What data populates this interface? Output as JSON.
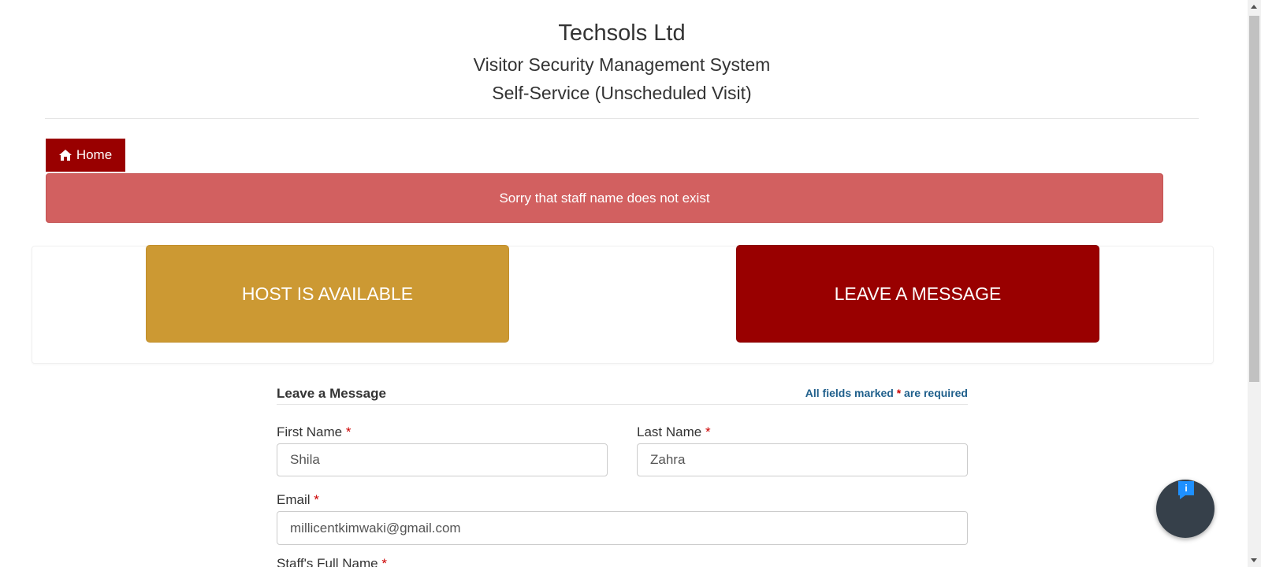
{
  "header": {
    "company": "Techsols Ltd",
    "system": "Visitor Security Management System",
    "mode": "Self-Service (Unscheduled Visit)"
  },
  "nav": {
    "home_label": "Home",
    "home_icon": "home-icon"
  },
  "alert": {
    "message": "Sorry that staff name does not exist",
    "color": "#d26060"
  },
  "actions": {
    "host_available": "HOST IS AVAILABLE",
    "leave_message": "LEAVE A MESSAGE",
    "host_color": "#cc9933",
    "leave_color": "#990000"
  },
  "form": {
    "title": "Leave a Message",
    "required_note_prefix": "All fields marked ",
    "required_star": "*",
    "required_note_suffix": " are required",
    "first_name": {
      "label": "First Name",
      "value": "Shila"
    },
    "last_name": {
      "label": "Last Name",
      "value": "Zahra"
    },
    "email": {
      "label": "Email",
      "value": "millicentkimwaki@gmail.com"
    },
    "staff_name": {
      "label": "Staff's Full Name"
    }
  },
  "chat": {
    "icon": "info-chat-icon",
    "badge": "i"
  }
}
